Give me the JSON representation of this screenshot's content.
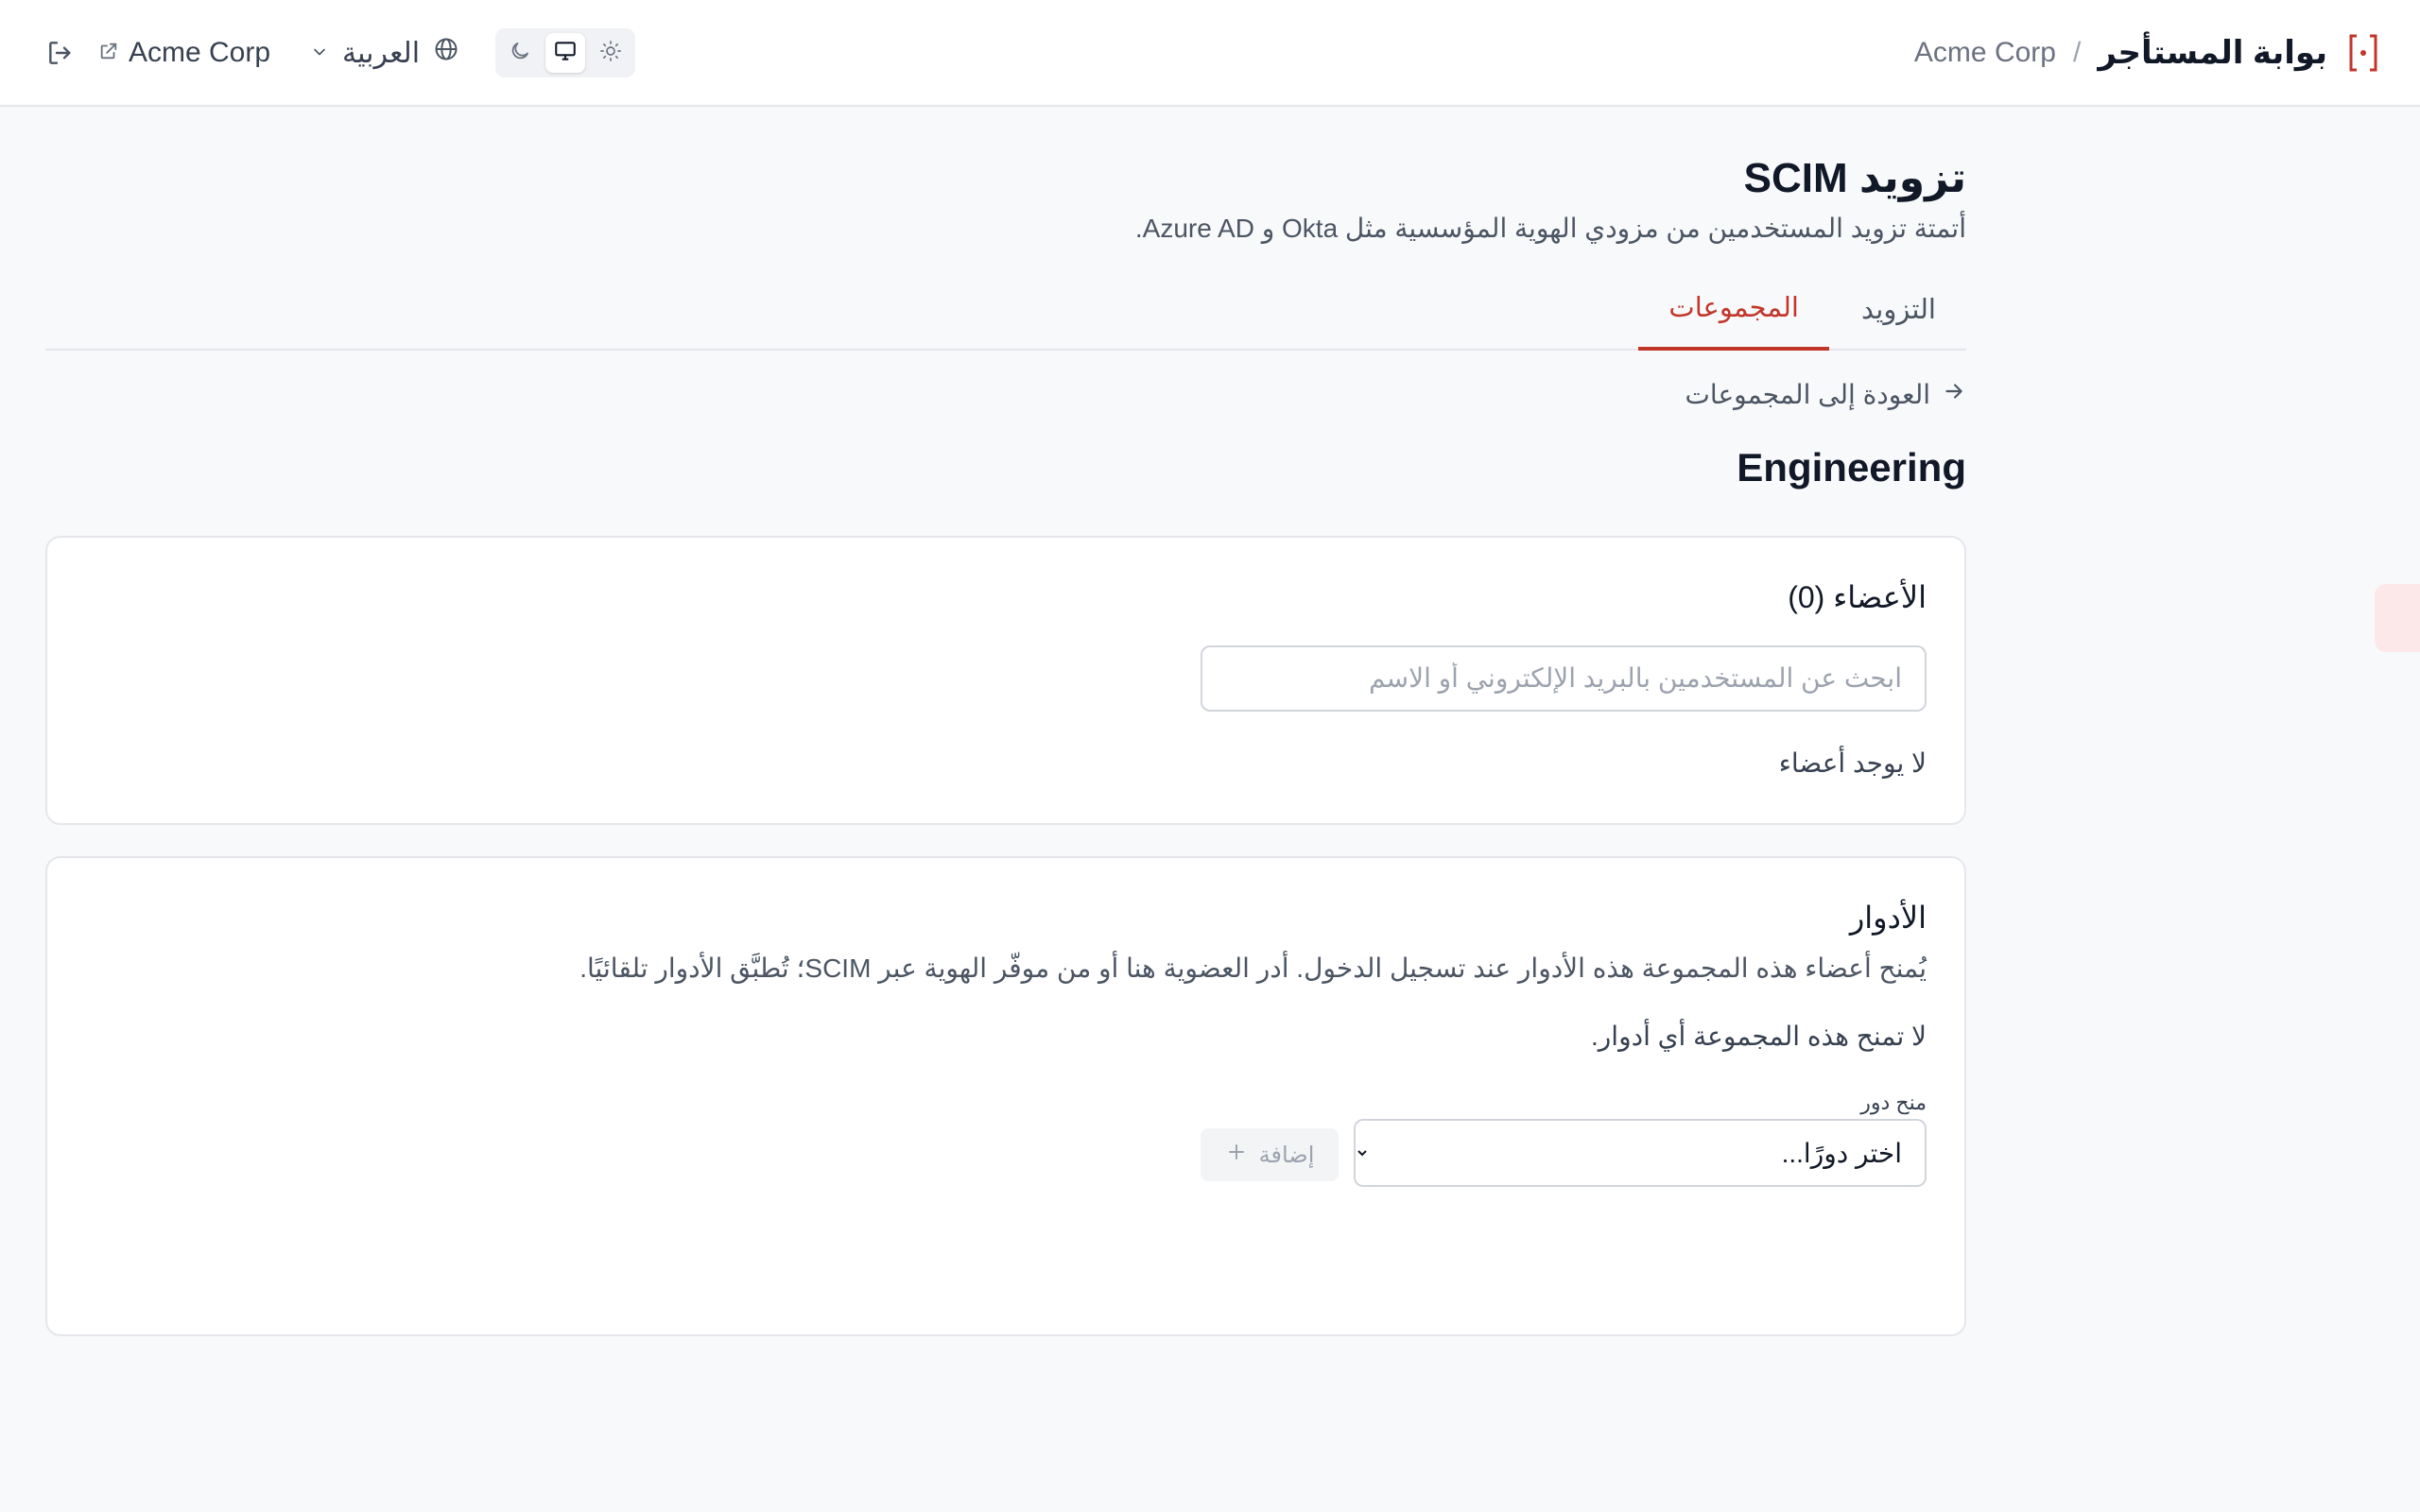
{
  "header": {
    "portal_title": "بوابة المستأجر",
    "separator": "/",
    "org_breadcrumb": "Acme Corp",
    "org_link_label": "Acme Corp",
    "language_label": "العربية",
    "theme_options": [
      "light",
      "system",
      "dark"
    ],
    "theme_selected": "system"
  },
  "page": {
    "title": "تزويد SCIM",
    "subtitle": "أتمتة تزويد المستخدمين من مزودي الهوية المؤسسية مثل Okta و Azure AD.",
    "tabs": [
      {
        "label": "التزويد",
        "active": false
      },
      {
        "label": "المجموعات",
        "active": true
      }
    ],
    "back_label": "العودة إلى المجموعات",
    "group_name": "Engineering"
  },
  "members": {
    "title": "الأعضاء (0)",
    "search_placeholder": "ابحث عن المستخدمين بالبريد الإلكتروني أو الاسم",
    "empty_text": "لا يوجد أعضاء"
  },
  "roles": {
    "title": "الأدوار",
    "description": "يُمنح أعضاء هذه المجموعة هذه الأدوار عند تسجيل الدخول. أدر العضوية هنا أو من موفّر الهوية عبر SCIM؛ تُطبَّق الأدوار تلقائيًا.",
    "empty_text": "لا تمنح هذه المجموعة أي أدوار.",
    "grant_label": "منح دور",
    "select_placeholder": "اختر دورًا...",
    "add_label": "إضافة"
  },
  "colors": {
    "accent": "#c2362a",
    "background": "#f8f9fb",
    "border": "#e5e7eb"
  }
}
